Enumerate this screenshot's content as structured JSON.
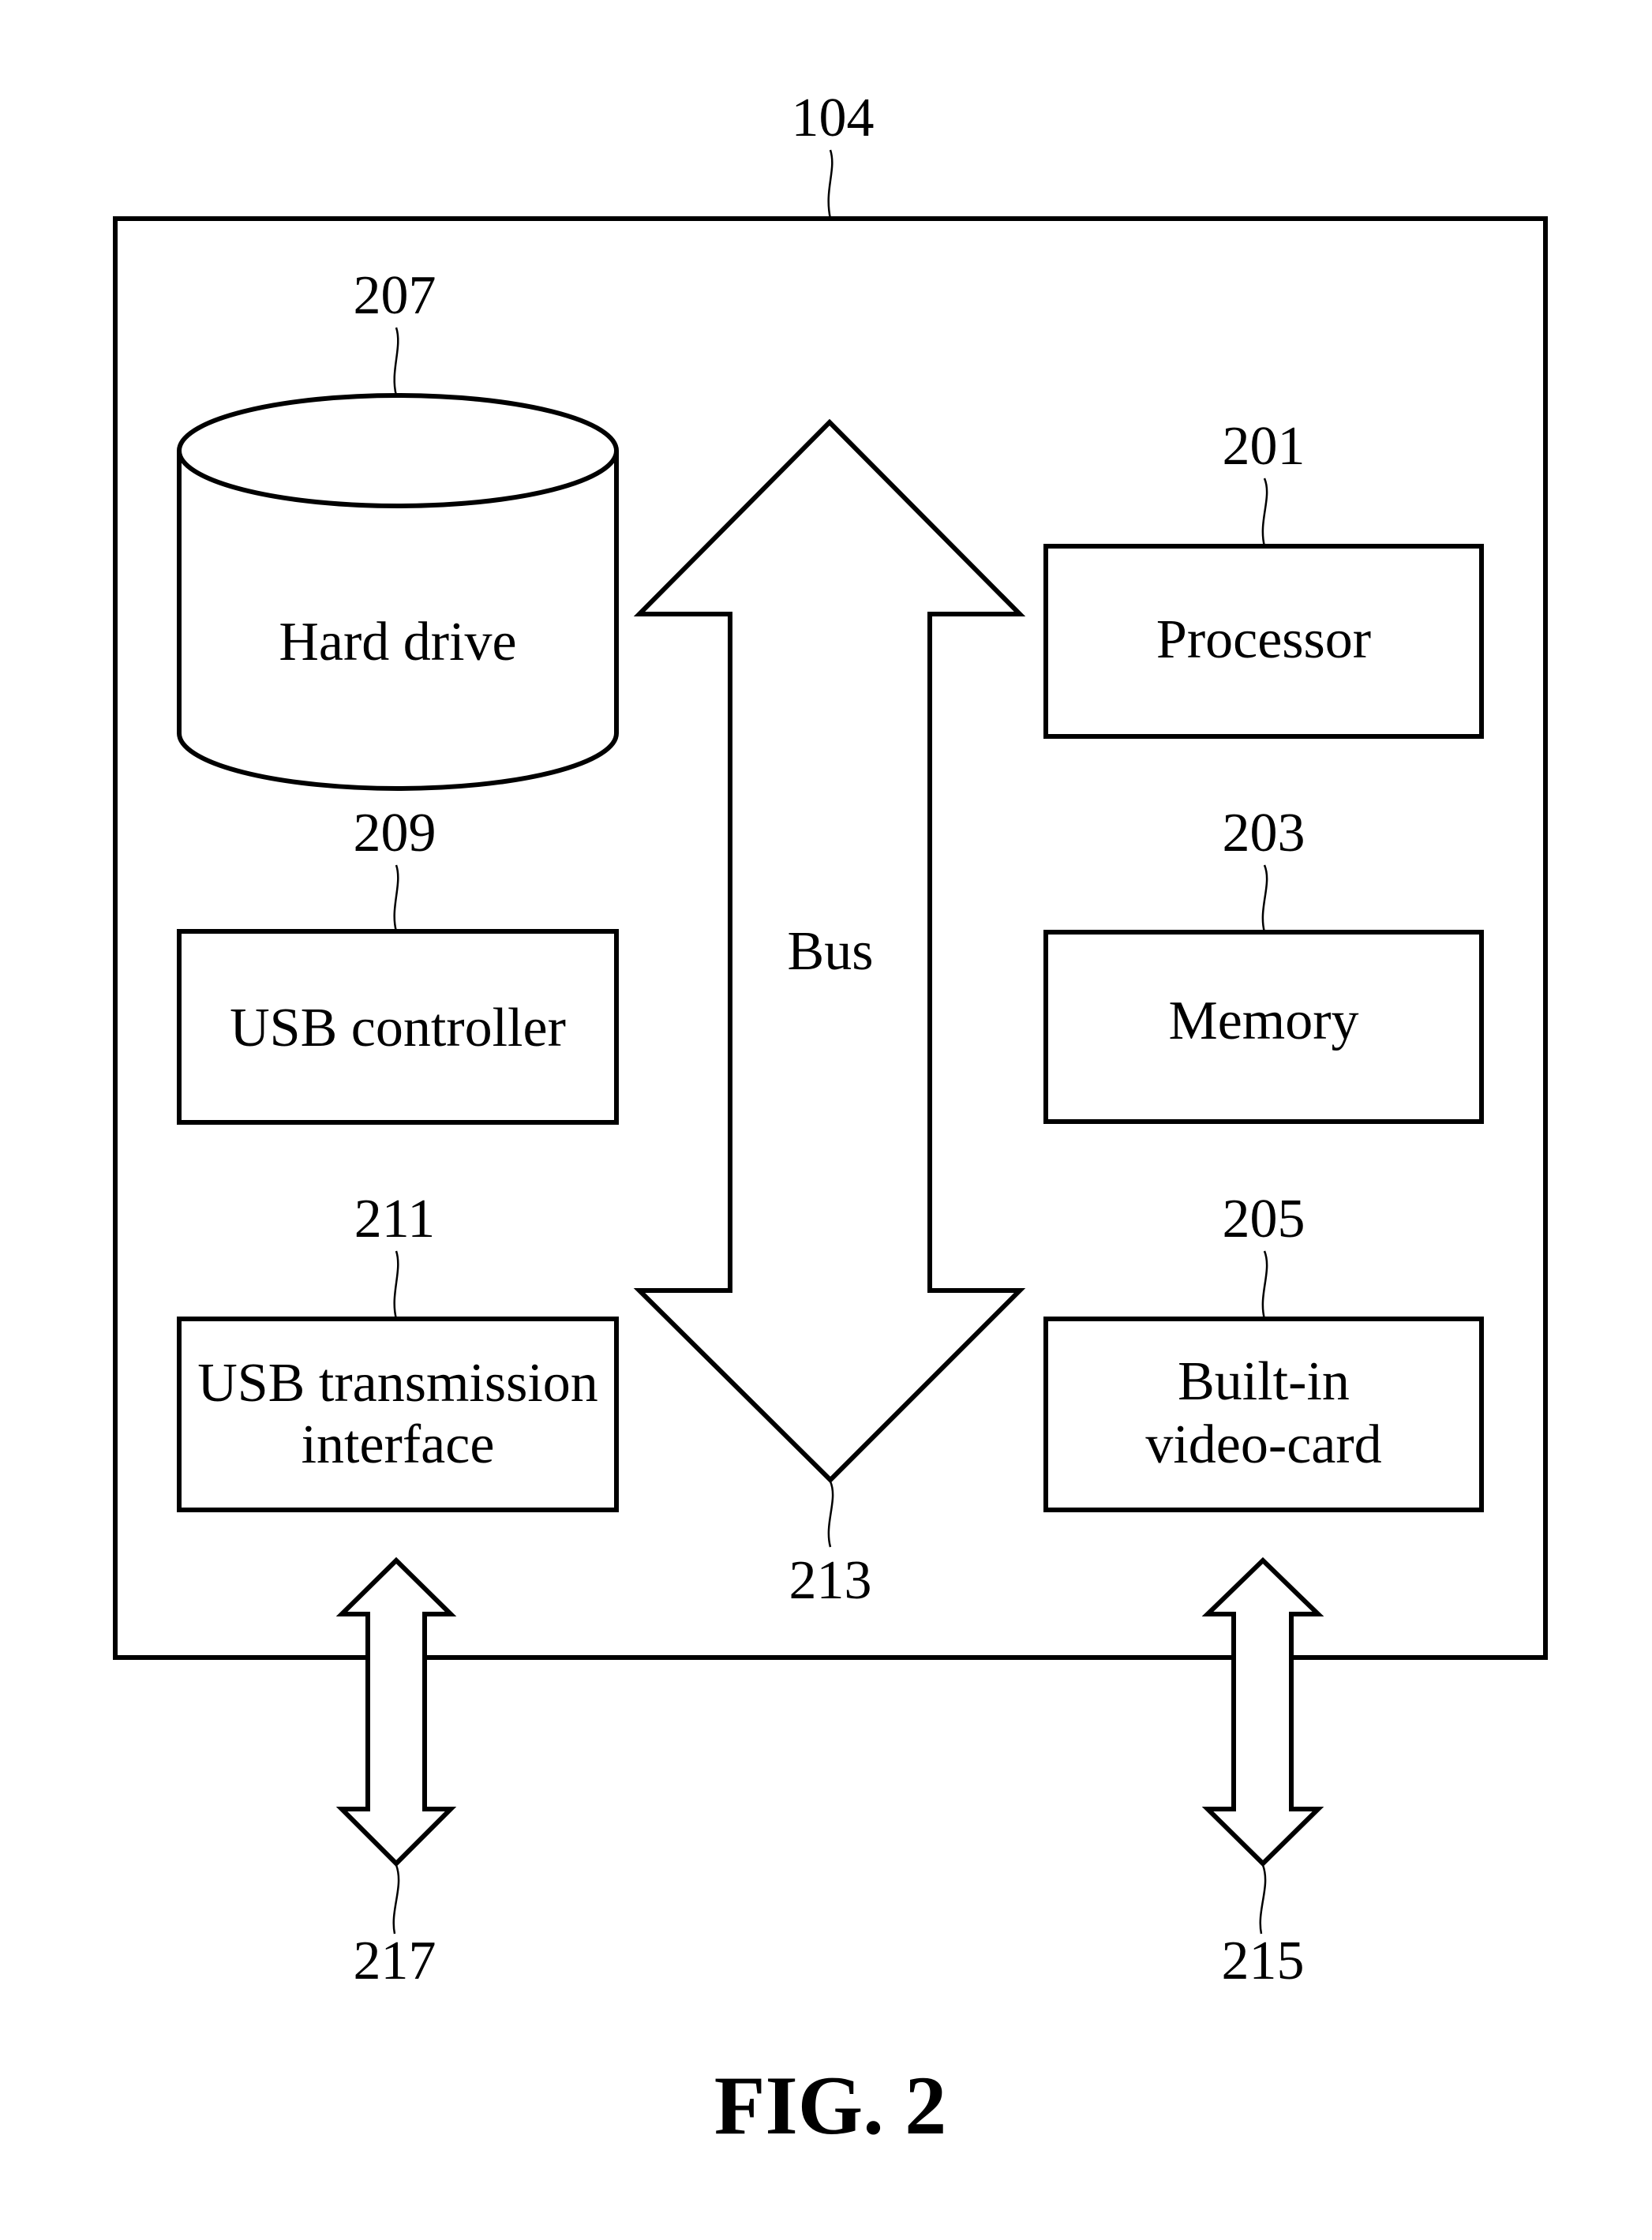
{
  "figure": {
    "caption": "FIG. 2",
    "device_ref": "104"
  },
  "components": {
    "hard_drive": {
      "ref": "207",
      "label": "Hard drive"
    },
    "usb_controller": {
      "ref": "209",
      "label": "USB controller"
    },
    "usb_interface": {
      "ref": "211",
      "label_line1": "USB transmission",
      "label_line2": "interface"
    },
    "processor": {
      "ref": "201",
      "label": "Processor"
    },
    "memory": {
      "ref": "203",
      "label": "Memory"
    },
    "video_card": {
      "ref": "205",
      "label_line1": "Built-in",
      "label_line2": "video-card"
    },
    "bus": {
      "ref": "213",
      "label": "Bus"
    }
  },
  "external_links": {
    "usb_link": {
      "ref": "217"
    },
    "video_link": {
      "ref": "215"
    }
  }
}
